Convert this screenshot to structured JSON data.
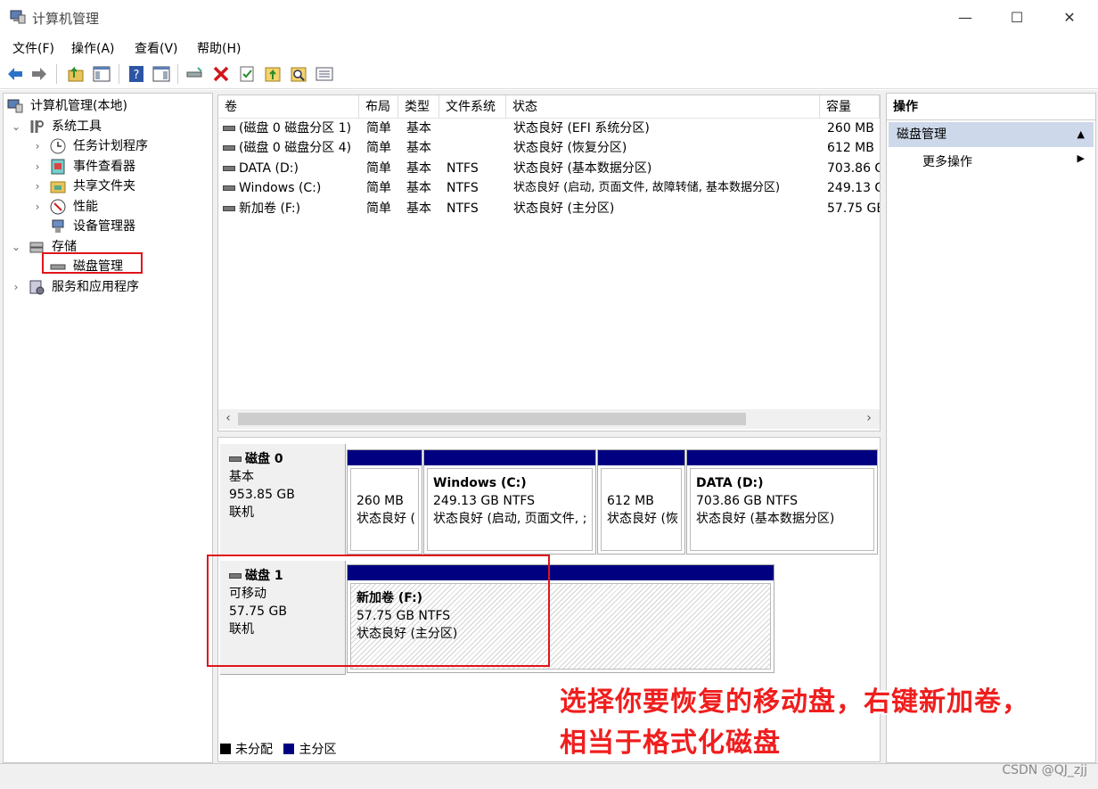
{
  "window": {
    "title": "计算机管理",
    "controls": {
      "minimize": "—",
      "maximize": "☐",
      "close": "✕"
    }
  },
  "menu": [
    "文件(F)",
    "操作(A)",
    "查看(V)",
    "帮助(H)"
  ],
  "toolbar_icons": [
    "back-icon",
    "forward-icon",
    "up-folder-icon",
    "show-hide-tree-icon",
    "help-icon",
    "show-hide-action-icon",
    "connect-drive-icon",
    "delete-icon",
    "properties-icon",
    "folder-up-icon",
    "search-folder-icon",
    "list-icon"
  ],
  "tree": {
    "root": "计算机管理(本地)",
    "system_tools": "系统工具",
    "task_scheduler": "任务计划程序",
    "event_viewer": "事件查看器",
    "shared_folders": "共享文件夹",
    "performance": "性能",
    "device_manager": "设备管理器",
    "storage": "存储",
    "disk_management": "磁盘管理",
    "services_apps": "服务和应用程序"
  },
  "volume_list": {
    "columns": [
      "卷",
      "布局",
      "类型",
      "文件系统",
      "状态",
      "容量"
    ],
    "rows": [
      [
        "(磁盘 0 磁盘分区 1)",
        "简单",
        "基本",
        "",
        "状态良好 (EFI 系统分区)",
        "260 MB"
      ],
      [
        "(磁盘 0 磁盘分区 4)",
        "简单",
        "基本",
        "",
        "状态良好 (恢复分区)",
        "612 MB"
      ],
      [
        "DATA (D:)",
        "简单",
        "基本",
        "NTFS",
        "状态良好 (基本数据分区)",
        "703.86 G"
      ],
      [
        "Windows (C:)",
        "简单",
        "基本",
        "NTFS",
        "状态良好 (启动, 页面文件, 故障转储, 基本数据分区)",
        "249.13 G"
      ],
      [
        "新加卷 (F:)",
        "简单",
        "基本",
        "NTFS",
        "状态良好 (主分区)",
        "57.75 GE"
      ]
    ]
  },
  "disks": [
    {
      "name": "磁盘 0",
      "kind": "基本",
      "size": "953.85 GB",
      "status": "联机",
      "partitions": [
        {
          "name": "",
          "line1": "260 MB",
          "line2": "状态良好 ("
        },
        {
          "name": "Windows  (C:)",
          "line1": "249.13 GB NTFS",
          "line2": "状态良好 (启动, 页面文件, ;"
        },
        {
          "name": "",
          "line1": "612 MB",
          "line2": "状态良好 (恢"
        },
        {
          "name": "DATA  (D:)",
          "line1": "703.86 GB NTFS",
          "line2": "状态良好 (基本数据分区)"
        }
      ]
    },
    {
      "name": "磁盘 1",
      "kind": "可移动",
      "size": "57.75 GB",
      "status": "联机",
      "partitions": [
        {
          "name": "新加卷  (F:)",
          "line1": "57.75 GB NTFS",
          "line2": "状态良好 (主分区)"
        }
      ]
    }
  ],
  "legend": {
    "unallocated": "未分配",
    "primary": "主分区"
  },
  "actions": {
    "header": "操作",
    "section": "磁盘管理",
    "more": "更多操作"
  },
  "annotation": {
    "line1": "选择你要恢复的移动盘，右键新加卷，",
    "line2": "相当于格式化磁盘"
  },
  "watermark": "CSDN @QJ_zjj",
  "colors": {
    "partition_bar": "#000080",
    "highlight": "#e0141b",
    "annotation": "#f01e1e",
    "action_selected": "#cdd9ea"
  }
}
